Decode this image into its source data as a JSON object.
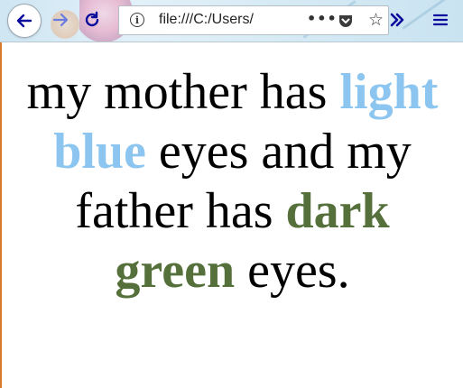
{
  "browser": {
    "url": "file:///C:/Users/"
  },
  "content": {
    "part1": "my mother has ",
    "highlight1": "light blue",
    "part2": " eyes and my father has ",
    "highlight2": "dark green",
    "part3": " eyes.",
    "highlight1_color": "#8cc6f0",
    "highlight2_color": "#55703a"
  },
  "icons": {
    "back": "back-arrow-icon",
    "forward": "forward-arrow-icon",
    "reload": "reload-icon",
    "info": "info-icon",
    "more": "more-icon",
    "pocket": "pocket-icon",
    "bookmark": "star-icon",
    "overflow": "overflow-chevron-icon",
    "menu": "hamburger-menu-icon"
  }
}
